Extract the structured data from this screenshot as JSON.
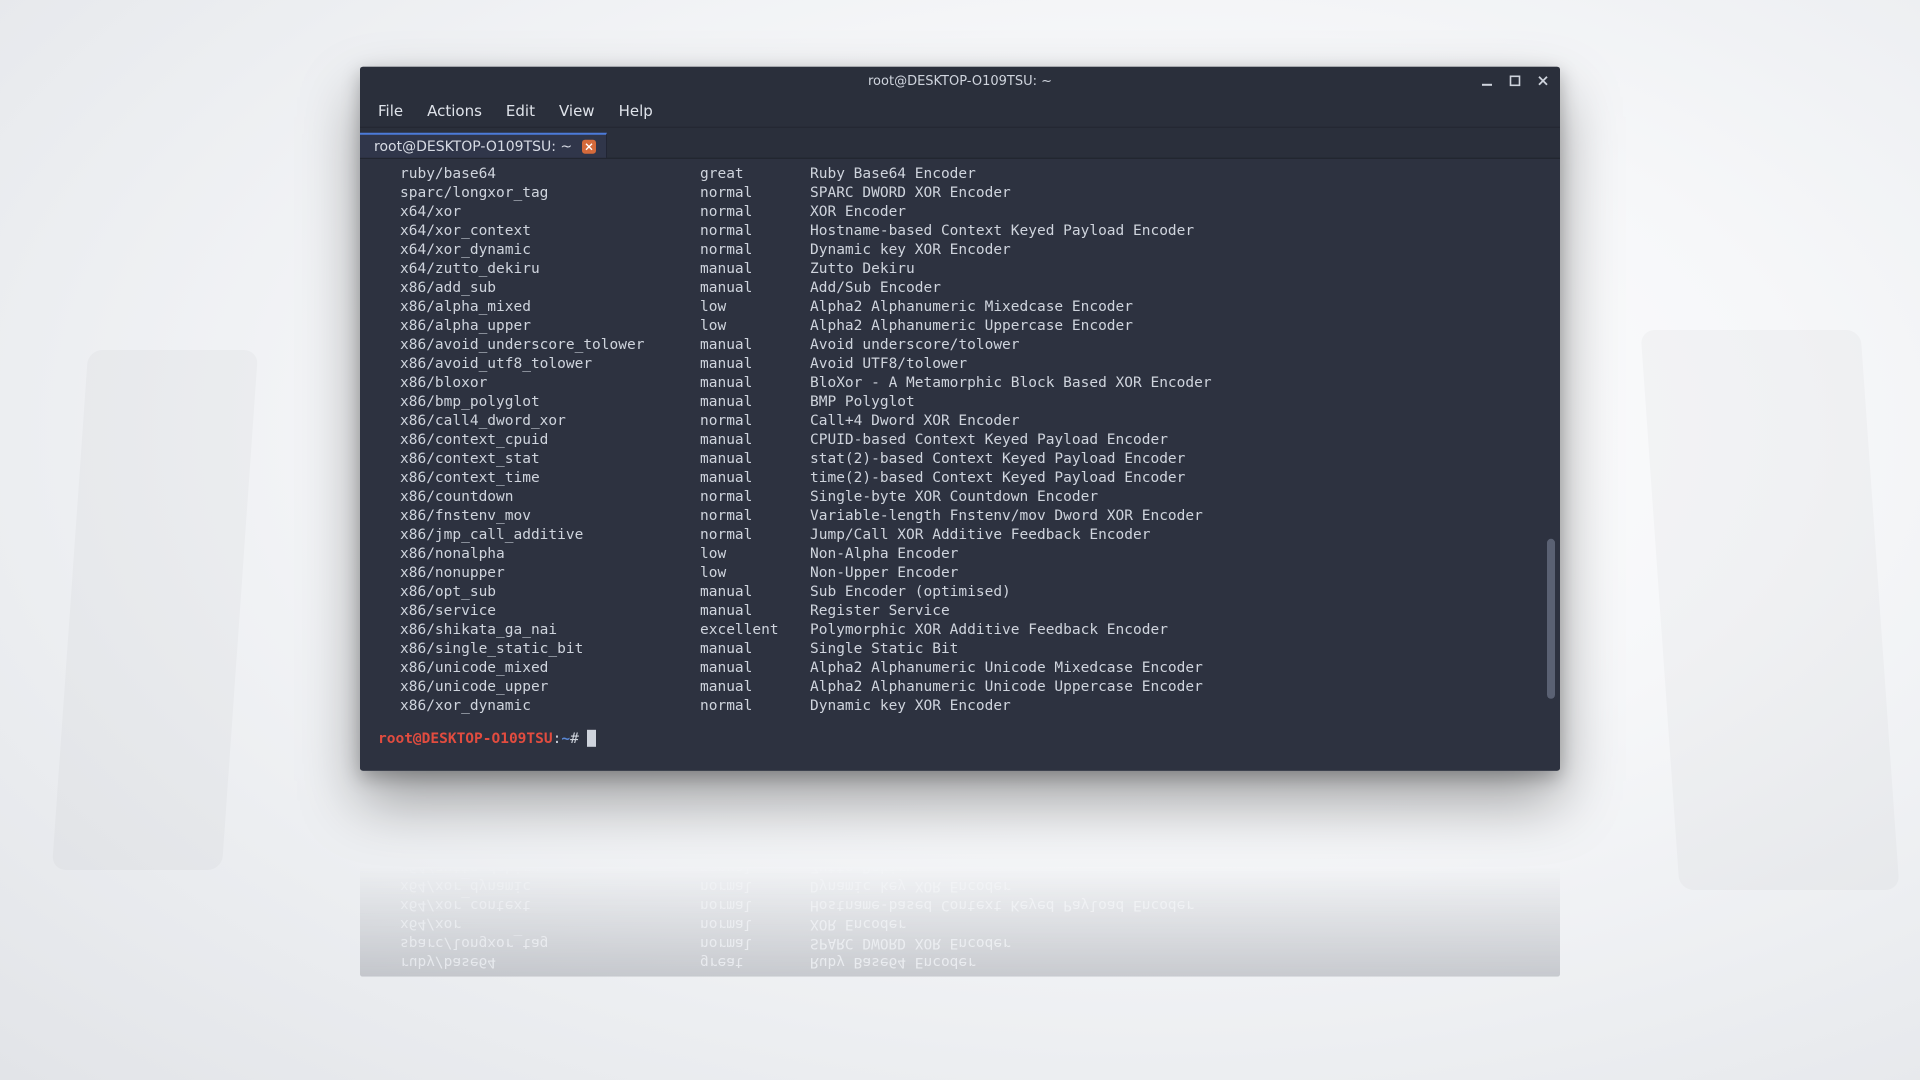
{
  "window": {
    "title": "root@DESKTOP-O109TSU: ~"
  },
  "menu": {
    "items": [
      "File",
      "Actions",
      "Edit",
      "View",
      "Help"
    ]
  },
  "tab": {
    "label": "root@DESKTOP-O109TSU: ~"
  },
  "prompt": {
    "user_host": "root@DESKTOP-O109TSU",
    "path": "~",
    "symbol": "#"
  },
  "encoders": [
    {
      "name": "ruby/base64",
      "rank": "great",
      "desc": "Ruby Base64 Encoder"
    },
    {
      "name": "sparc/longxor_tag",
      "rank": "normal",
      "desc": "SPARC DWORD XOR Encoder"
    },
    {
      "name": "x64/xor",
      "rank": "normal",
      "desc": "XOR Encoder"
    },
    {
      "name": "x64/xor_context",
      "rank": "normal",
      "desc": "Hostname-based Context Keyed Payload Encoder"
    },
    {
      "name": "x64/xor_dynamic",
      "rank": "normal",
      "desc": "Dynamic key XOR Encoder"
    },
    {
      "name": "x64/zutto_dekiru",
      "rank": "manual",
      "desc": "Zutto Dekiru"
    },
    {
      "name": "x86/add_sub",
      "rank": "manual",
      "desc": "Add/Sub Encoder"
    },
    {
      "name": "x86/alpha_mixed",
      "rank": "low",
      "desc": "Alpha2 Alphanumeric Mixedcase Encoder"
    },
    {
      "name": "x86/alpha_upper",
      "rank": "low",
      "desc": "Alpha2 Alphanumeric Uppercase Encoder"
    },
    {
      "name": "x86/avoid_underscore_tolower",
      "rank": "manual",
      "desc": "Avoid underscore/tolower"
    },
    {
      "name": "x86/avoid_utf8_tolower",
      "rank": "manual",
      "desc": "Avoid UTF8/tolower"
    },
    {
      "name": "x86/bloxor",
      "rank": "manual",
      "desc": "BloXor - A Metamorphic Block Based XOR Encoder"
    },
    {
      "name": "x86/bmp_polyglot",
      "rank": "manual",
      "desc": "BMP Polyglot"
    },
    {
      "name": "x86/call4_dword_xor",
      "rank": "normal",
      "desc": "Call+4 Dword XOR Encoder"
    },
    {
      "name": "x86/context_cpuid",
      "rank": "manual",
      "desc": "CPUID-based Context Keyed Payload Encoder"
    },
    {
      "name": "x86/context_stat",
      "rank": "manual",
      "desc": "stat(2)-based Context Keyed Payload Encoder"
    },
    {
      "name": "x86/context_time",
      "rank": "manual",
      "desc": "time(2)-based Context Keyed Payload Encoder"
    },
    {
      "name": "x86/countdown",
      "rank": "normal",
      "desc": "Single-byte XOR Countdown Encoder"
    },
    {
      "name": "x86/fnstenv_mov",
      "rank": "normal",
      "desc": "Variable-length Fnstenv/mov Dword XOR Encoder"
    },
    {
      "name": "x86/jmp_call_additive",
      "rank": "normal",
      "desc": "Jump/Call XOR Additive Feedback Encoder"
    },
    {
      "name": "x86/nonalpha",
      "rank": "low",
      "desc": "Non-Alpha Encoder"
    },
    {
      "name": "x86/nonupper",
      "rank": "low",
      "desc": "Non-Upper Encoder"
    },
    {
      "name": "x86/opt_sub",
      "rank": "manual",
      "desc": "Sub Encoder (optimised)"
    },
    {
      "name": "x86/service",
      "rank": "manual",
      "desc": "Register Service"
    },
    {
      "name": "x86/shikata_ga_nai",
      "rank": "excellent",
      "desc": "Polymorphic XOR Additive Feedback Encoder"
    },
    {
      "name": "x86/single_static_bit",
      "rank": "manual",
      "desc": "Single Static Bit"
    },
    {
      "name": "x86/unicode_mixed",
      "rank": "manual",
      "desc": "Alpha2 Alphanumeric Unicode Mixedcase Encoder"
    },
    {
      "name": "x86/unicode_upper",
      "rank": "manual",
      "desc": "Alpha2 Alphanumeric Unicode Uppercase Encoder"
    },
    {
      "name": "x86/xor_dynamic",
      "rank": "normal",
      "desc": "Dynamic key XOR Encoder"
    }
  ]
}
